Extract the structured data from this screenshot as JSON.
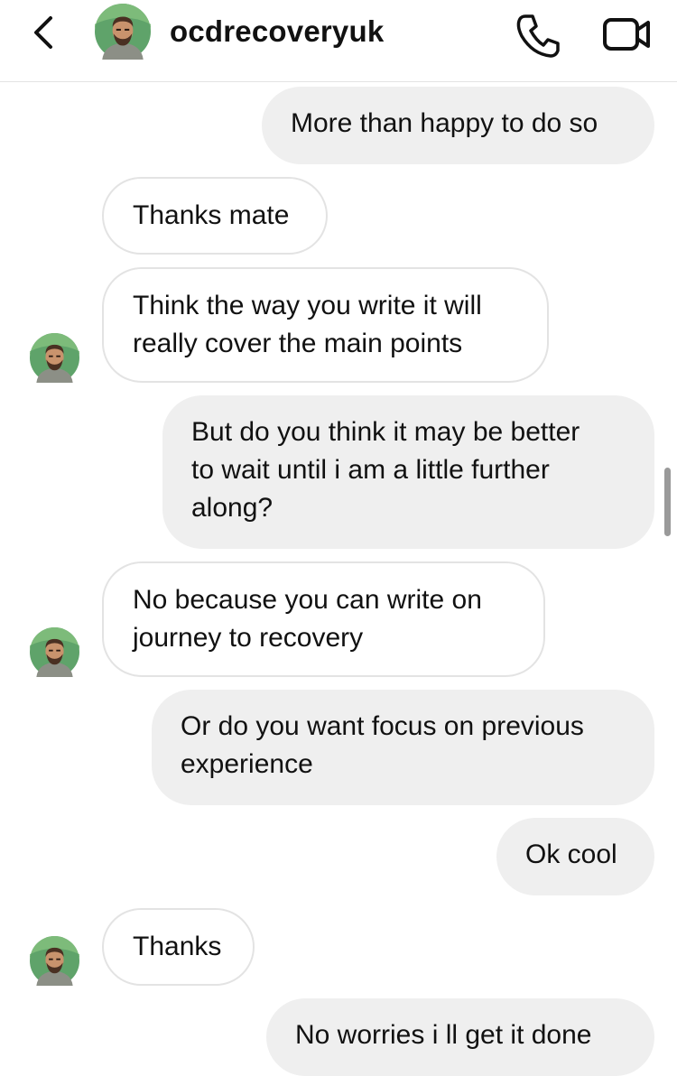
{
  "header": {
    "username": "ocdrecoveryuk",
    "back_icon": "chevron-left",
    "call_icon": "phone",
    "video_icon": "video-camera"
  },
  "messages": [
    {
      "direction": "outgoing",
      "text": "More than happy to do so"
    },
    {
      "direction": "incoming",
      "text": "Thanks mate"
    },
    {
      "direction": "incoming",
      "lines": [
        "Think the way you write it will",
        "really cover the main points"
      ]
    },
    {
      "direction": "outgoing",
      "lines": [
        "But do you think it may be better",
        "to wait until i am a little further",
        "along?"
      ]
    },
    {
      "direction": "incoming",
      "lines": [
        "No because you can write on",
        "journey to recovery"
      ]
    },
    {
      "direction": "outgoing",
      "lines": [
        "Or do you want focus on previous",
        "experience"
      ]
    },
    {
      "direction": "outgoing",
      "text": "Ok cool"
    },
    {
      "direction": "incoming",
      "text": "Thanks"
    },
    {
      "direction": "outgoing",
      "text": "No worries i ll get it done"
    }
  ],
  "colors": {
    "outgoing_bubble": "#efefef",
    "incoming_border": "#e3e3e3"
  }
}
